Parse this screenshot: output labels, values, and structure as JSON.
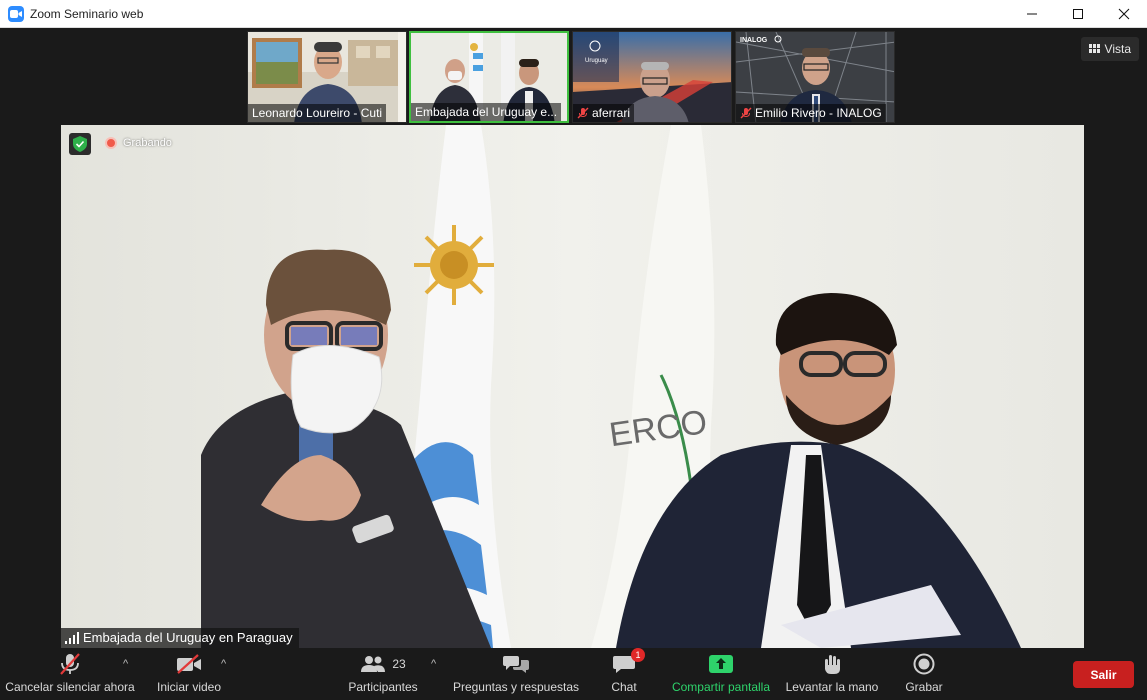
{
  "window": {
    "title": "Zoom Seminario web",
    "icon": "zoom-icon",
    "controls": [
      "minimize-icon",
      "maximize-icon",
      "close-icon"
    ]
  },
  "view_button": {
    "label": "Vista",
    "icon": "grid-icon"
  },
  "thumbnails": [
    {
      "name": "Leonardo Loureiro - Cuti",
      "muted": false,
      "active": false
    },
    {
      "name": "Embajada del Uruguay e...",
      "muted": false,
      "active": true
    },
    {
      "name": "aferrari",
      "muted": true,
      "active": false
    },
    {
      "name": "Emilio Rivero - INALOG",
      "muted": true,
      "active": false
    }
  ],
  "thumbnail_overlay_text": {
    "inalog_logo": "INALOG",
    "uruguay_logo": "Uruguay"
  },
  "main_video": {
    "recording_label": "Grabando",
    "speaker_name": "Embajada del Uruguay en Paraguay",
    "flag_text": "ERCO",
    "security_icon": "shield-check-icon"
  },
  "toolbar": {
    "mute": {
      "label": "Cancelar silenciar ahora",
      "icon": "microphone-muted-icon"
    },
    "video": {
      "label": "Iniciar video",
      "icon": "video-off-icon"
    },
    "participants": {
      "label": "Participantes",
      "count": "23",
      "icon": "participants-icon"
    },
    "qa": {
      "label": "Preguntas y respuestas",
      "icon": "qa-icon"
    },
    "chat": {
      "label": "Chat",
      "badge": "1",
      "icon": "chat-icon"
    },
    "share": {
      "label": "Compartir pantalla",
      "icon": "share-screen-icon"
    },
    "raise_hand": {
      "label": "Levantar la mano",
      "icon": "hand-icon"
    },
    "record": {
      "label": "Grabar",
      "icon": "record-icon"
    },
    "exit": {
      "label": "Salir"
    }
  },
  "colors": {
    "accent_green": "#2ed36b",
    "exit_red": "#c8201f",
    "zoom_blue": "#2D8CFF",
    "active_speaker_border": "#3fbf3f"
  }
}
